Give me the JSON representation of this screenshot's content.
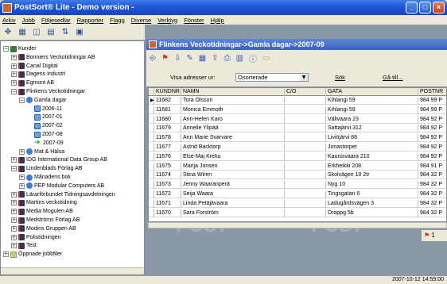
{
  "window": {
    "title": "PostSort® Lite - Demo version -",
    "min": "_",
    "max": "□",
    "close": "×"
  },
  "menu": [
    "Arkiv",
    "Jobb",
    "Följesedlar",
    "Rapporter",
    "Flagg",
    "Diverse",
    "Verktyg",
    "Fönster",
    "Hjälp"
  ],
  "tree": [
    {
      "label": "Kunder",
      "level": 0,
      "pm": "−",
      "icon": "kund"
    },
    {
      "label": "Bonniers Veckotidningar AB",
      "level": 1,
      "pm": "+",
      "icon": "book"
    },
    {
      "label": "Canal Digital",
      "level": 1,
      "pm": "+",
      "icon": "book"
    },
    {
      "label": "Dagens Industri",
      "level": 1,
      "pm": "+",
      "icon": "book"
    },
    {
      "label": "Egmont AB",
      "level": 1,
      "pm": "+",
      "icon": "book"
    },
    {
      "label": "Flinkens Veckotidningar",
      "level": 1,
      "pm": "−",
      "icon": "book"
    },
    {
      "label": "Gamla dagar",
      "level": 2,
      "pm": "−",
      "icon": "net"
    },
    {
      "label": "2006-11",
      "level": 3,
      "pm": "",
      "icon": "doc"
    },
    {
      "label": "2007-01",
      "level": 3,
      "pm": "",
      "icon": "doc"
    },
    {
      "label": "2007-02",
      "level": 3,
      "pm": "",
      "icon": "doc"
    },
    {
      "label": "2007-08",
      "level": 3,
      "pm": "",
      "icon": "doc"
    },
    {
      "label": "2007-09",
      "level": 3,
      "pm": "",
      "icon": "arrow"
    },
    {
      "label": "Mat & Hälsa",
      "level": 2,
      "pm": "+",
      "icon": "net"
    },
    {
      "label": "IDG International Data Group AB",
      "level": 1,
      "pm": "+",
      "icon": "book"
    },
    {
      "label": "Lindenblads Förlag AB",
      "level": 1,
      "pm": "−",
      "icon": "book"
    },
    {
      "label": "Månadens bok",
      "level": 2,
      "pm": "+",
      "icon": "net"
    },
    {
      "label": "PEP Modular Computers AB",
      "level": 2,
      "pm": "+",
      "icon": "net"
    },
    {
      "label": "Lärarförbundet Tidningsavdelningen",
      "level": 1,
      "pm": "+",
      "icon": "book"
    },
    {
      "label": "Martins veckotidning",
      "level": 1,
      "pm": "+",
      "icon": "book"
    },
    {
      "label": "Media Mogulen AB",
      "level": 1,
      "pm": "+",
      "icon": "book"
    },
    {
      "label": "Medströms Förlag AB",
      "level": 1,
      "pm": "+",
      "icon": "book"
    },
    {
      "label": "Modins Gruppen AB",
      "level": 1,
      "pm": "+",
      "icon": "book"
    },
    {
      "label": "Polistidningen",
      "level": 1,
      "pm": "+",
      "icon": "book"
    },
    {
      "label": "Test",
      "level": 1,
      "pm": "+",
      "icon": "book"
    },
    {
      "label": "Öppnade jobbfiler",
      "level": 0,
      "pm": "+",
      "icon": "open"
    }
  ],
  "child": {
    "title": "Flinkens Veckotidningar->Gamla dagar->2007-09"
  },
  "filter": {
    "label": "Visa adresser ur:",
    "value": "Osorterade",
    "search": "Sök",
    "goto": "Gå till..."
  },
  "grid": {
    "headers": [
      "KUNDNR",
      "NAMN",
      "C/O",
      "GATA",
      "POSTNR"
    ],
    "rows": [
      [
        "11682",
        "Tora Olsson",
        "",
        "Kihlangi 59",
        "984 99 P"
      ],
      [
        "11681",
        "Monica Emmoth",
        "",
        "Kihlangi 59",
        "984 99 P"
      ],
      [
        "11680",
        "Ann-Helen Karo",
        "",
        "Välivaara 23",
        "984 92 P"
      ],
      [
        "11679",
        "Annelie Ylipää",
        "",
        "Sattajärvi 312",
        "984 92 P"
      ],
      [
        "11678",
        "Ann Marie Svarvare",
        "",
        "Liviöjärvi 88",
        "984 92 P"
      ],
      [
        "11677",
        "Astrid Backtorp",
        "",
        "Jonastorpet",
        "984 92 P"
      ],
      [
        "11676",
        "Else-Maj Kreku",
        "",
        "Kaunisvaara 210",
        "984 92 P"
      ],
      [
        "11675",
        "Marija Jonsen",
        "",
        "Erkheikki 208",
        "984 91 P"
      ],
      [
        "11674",
        "Stina Wiren",
        "",
        "Skolvägen 10 2tr",
        "984 32 P"
      ],
      [
        "11673",
        "Jenny Waaranperä",
        "",
        "Nyg 10",
        "984 32 P"
      ],
      [
        "11672",
        "Seija Waara",
        "",
        "Tingsgatan 6",
        "984 32 P"
      ],
      [
        "11671",
        "Linda Petäjävaara",
        "",
        "Ladugårdsvägen 3",
        "984 32 P"
      ],
      [
        "11670",
        "Sara Forström",
        "",
        "Droppg 5b",
        "984 32 P"
      ]
    ]
  },
  "panel_page": "1",
  "status": {
    "time": "2007-10-12 14:59:00"
  }
}
